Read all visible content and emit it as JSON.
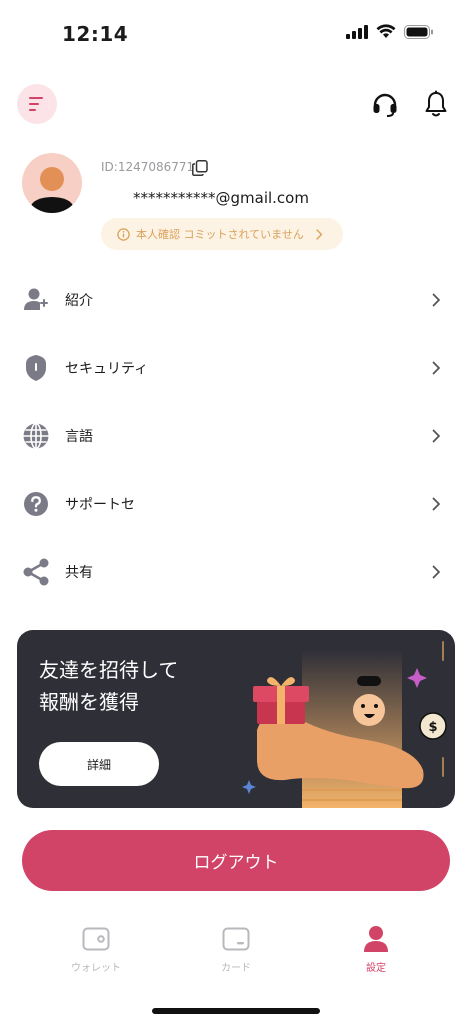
{
  "status_bar": {
    "time": "12:14"
  },
  "header": {
    "menu_icon": "menu-lines-icon",
    "support_icon": "headset-icon",
    "notifications_icon": "bell-icon"
  },
  "profile": {
    "id_text": "ID:1247086771",
    "email": "***********@gmail.com",
    "kyc_banner": "本人確認 コミットされていません"
  },
  "menu": {
    "items": [
      {
        "label": "紹介",
        "icon": "add-user-icon"
      },
      {
        "label": "セキュリティ",
        "icon": "shield-icon"
      },
      {
        "label": "言語",
        "icon": "globe-icon"
      },
      {
        "label": "サポートセ",
        "icon": "help-icon"
      },
      {
        "label": "共有",
        "icon": "share-icon"
      }
    ]
  },
  "invite": {
    "title_line1": "友達を招待して",
    "title_line2": "報酬を獲得",
    "details_label": "詳細"
  },
  "logout": {
    "label": "ログアウト"
  },
  "tabs": [
    {
      "label": "ウォレット",
      "icon": "wallet-icon",
      "active": false
    },
    {
      "label": "カード",
      "icon": "card-icon",
      "active": false
    },
    {
      "label": "設定",
      "icon": "profile-icon",
      "active": true
    }
  ],
  "colors": {
    "accent": "#d14468",
    "menu_button_bg": "#fbe3e8",
    "kyc_bg": "#fdf3e4",
    "kyc_text": "#d9a25a",
    "card_bg": "#2f2f38",
    "icon_gray": "#7a7b87"
  }
}
